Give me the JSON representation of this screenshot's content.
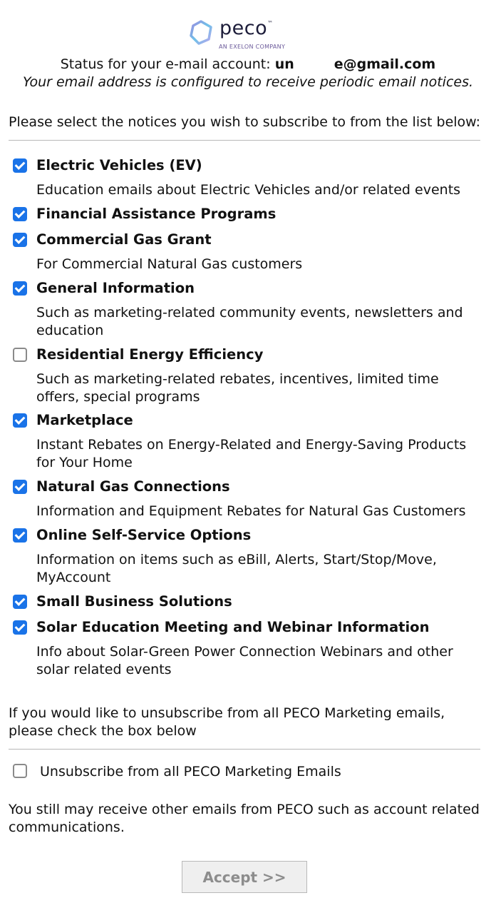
{
  "header": {
    "logo_text": "peco",
    "logo_tm": "™",
    "logo_tagline": "AN EXELON COMPANY",
    "status_prefix": "Status for your e-mail account: ",
    "email_start": "un",
    "email_end": "e@gmail.com",
    "configured_text": "Your email address is configured to receive periodic email notices."
  },
  "intro_text": "Please select the notices you wish to subscribe to from the list below:",
  "notices": [
    {
      "title": "Electric Vehicles (EV)",
      "checked": true,
      "desc": "Education emails about Electric Vehicles and/or related events"
    },
    {
      "title": "Financial Assistance Programs",
      "checked": true,
      "desc": ""
    },
    {
      "title": "Commercial Gas Grant",
      "checked": true,
      "desc": "For Commercial Natural Gas customers"
    },
    {
      "title": "General Information",
      "checked": true,
      "desc": "Such as marketing-related community events, newsletters and education"
    },
    {
      "title": "Residential Energy Efficiency",
      "checked": false,
      "desc": "Such as marketing-related rebates, incentives, limited time offers, special programs"
    },
    {
      "title": "Marketplace",
      "checked": true,
      "desc": "Instant Rebates on Energy-Related and Energy-Saving Products for Your Home"
    },
    {
      "title": "Natural Gas Connections",
      "checked": true,
      "desc": "Information and Equipment Rebates for Natural Gas Customers"
    },
    {
      "title": "Online Self-Service Options",
      "checked": true,
      "desc": "Information on items such as eBill, Alerts, Start/Stop/Move, MyAccount"
    },
    {
      "title": "Small Business Solutions",
      "checked": true,
      "desc": ""
    },
    {
      "title": "Solar Education Meeting and Webinar Information",
      "checked": true,
      "desc": "Info about Solar-Green Power Connection Webinars and other solar related events"
    }
  ],
  "unsubscribe": {
    "note": "If you would like to unsubscribe from all PECO Marketing emails, please check the box below",
    "label": "Unsubscribe from all PECO Marketing Emails",
    "checked": false
  },
  "footer_note": "You still may receive other emails from PECO such as account related communications.",
  "accept_label": "Accept >>",
  "colors": {
    "checkbox_checked": "#1a73e8",
    "logo_accent": "#7b6fd6"
  }
}
